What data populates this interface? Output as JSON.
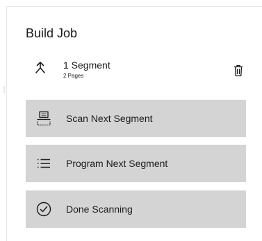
{
  "panel": {
    "title": "Build Job"
  },
  "job": {
    "icon": "merge-arrow-icon",
    "name": "1 Segment",
    "pages": "2 Pages",
    "delete_icon": "trash-icon"
  },
  "actions": [
    {
      "label": "Scan Next Segment",
      "icon": "scanner-icon"
    },
    {
      "label": "Program Next Segment",
      "icon": "list-icon"
    },
    {
      "label": "Done Scanning",
      "icon": "check-circle-icon"
    }
  ],
  "colors": {
    "button_background": "#d4d4d4",
    "text": "#1a1a1a",
    "panel_border": "#e6e6e6"
  }
}
